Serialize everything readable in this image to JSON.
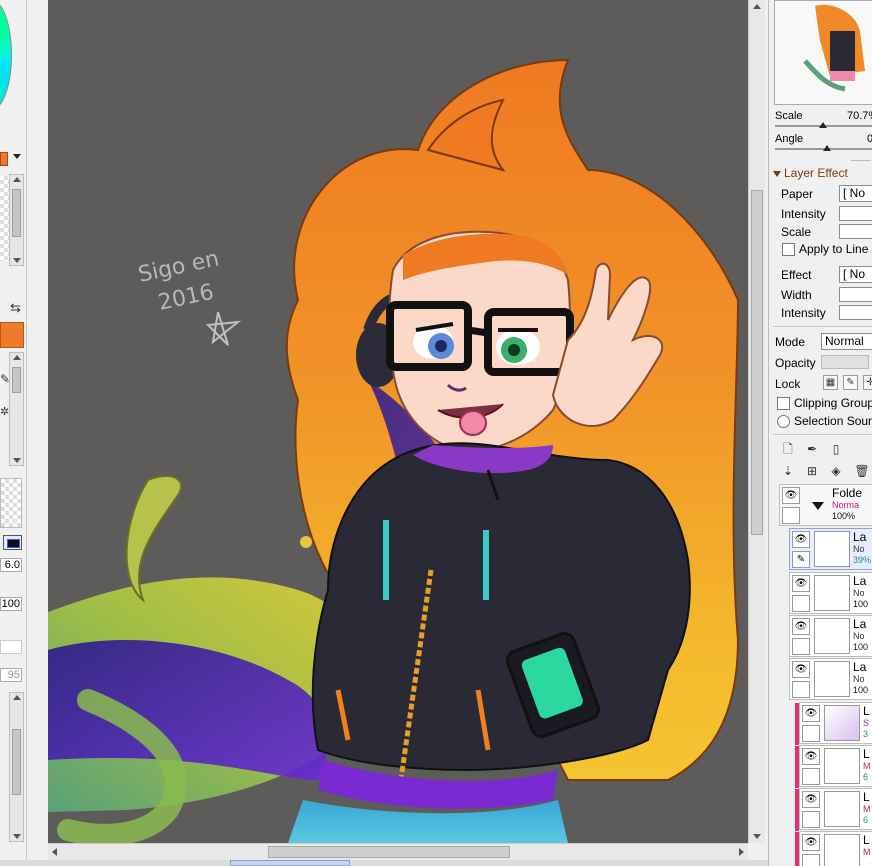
{
  "left_panel": {
    "value_1": "6.0",
    "value_2": "100",
    "value_3": "95"
  },
  "canvas": {
    "signature_line1": "Sigo en",
    "signature_line2": "2016"
  },
  "right_panel": {
    "scale_label": "Scale",
    "scale_value": "70.7%",
    "angle_label": "Angle",
    "angle_value": "0",
    "layer_effect_title": "Layer Effect",
    "paper_label": "Paper",
    "paper_value": "[ No",
    "intensity_label": "Intensity",
    "scale2_label": "Scale",
    "apply_to_line_label": "Apply to Line",
    "effect_label": "Effect",
    "effect_value": "[ No",
    "width_label": "Width",
    "intensity2_label": "Intensity",
    "mode_label": "Mode",
    "mode_value": "Normal",
    "opacity_label": "Opacity",
    "lock_label": "Lock",
    "clipping_group_label": "Clipping Group",
    "selection_source_label": "Selection Sour"
  },
  "layers": [
    {
      "name": "Folde",
      "mode": "Norma",
      "opacity": "100%",
      "type": "folder"
    },
    {
      "name": "La",
      "mode": "No",
      "opacity": "39%",
      "type": "selected"
    },
    {
      "name": "La",
      "mode": "No",
      "opacity": "100",
      "type": "normal"
    },
    {
      "name": "La",
      "mode": "No",
      "opacity": "100",
      "type": "normal"
    },
    {
      "name": "La",
      "mode": "No",
      "opacity": "100",
      "type": "normal"
    },
    {
      "name": "L",
      "mode": "S",
      "opacity": "3",
      "type": "clipped"
    },
    {
      "name": "L",
      "mode": "M",
      "opacity": "6",
      "type": "clipped"
    },
    {
      "name": "L",
      "mode": "M",
      "opacity": "6",
      "type": "clipped"
    },
    {
      "name": "L",
      "mode": "M",
      "opacity": "",
      "type": "clipped"
    }
  ],
  "colors": {
    "canvas_bg": "#5d5c5a",
    "accent_orange": "#ee7a2a",
    "layer_effect_header": "#7a3c0a",
    "clip_marker": "#e03070"
  }
}
